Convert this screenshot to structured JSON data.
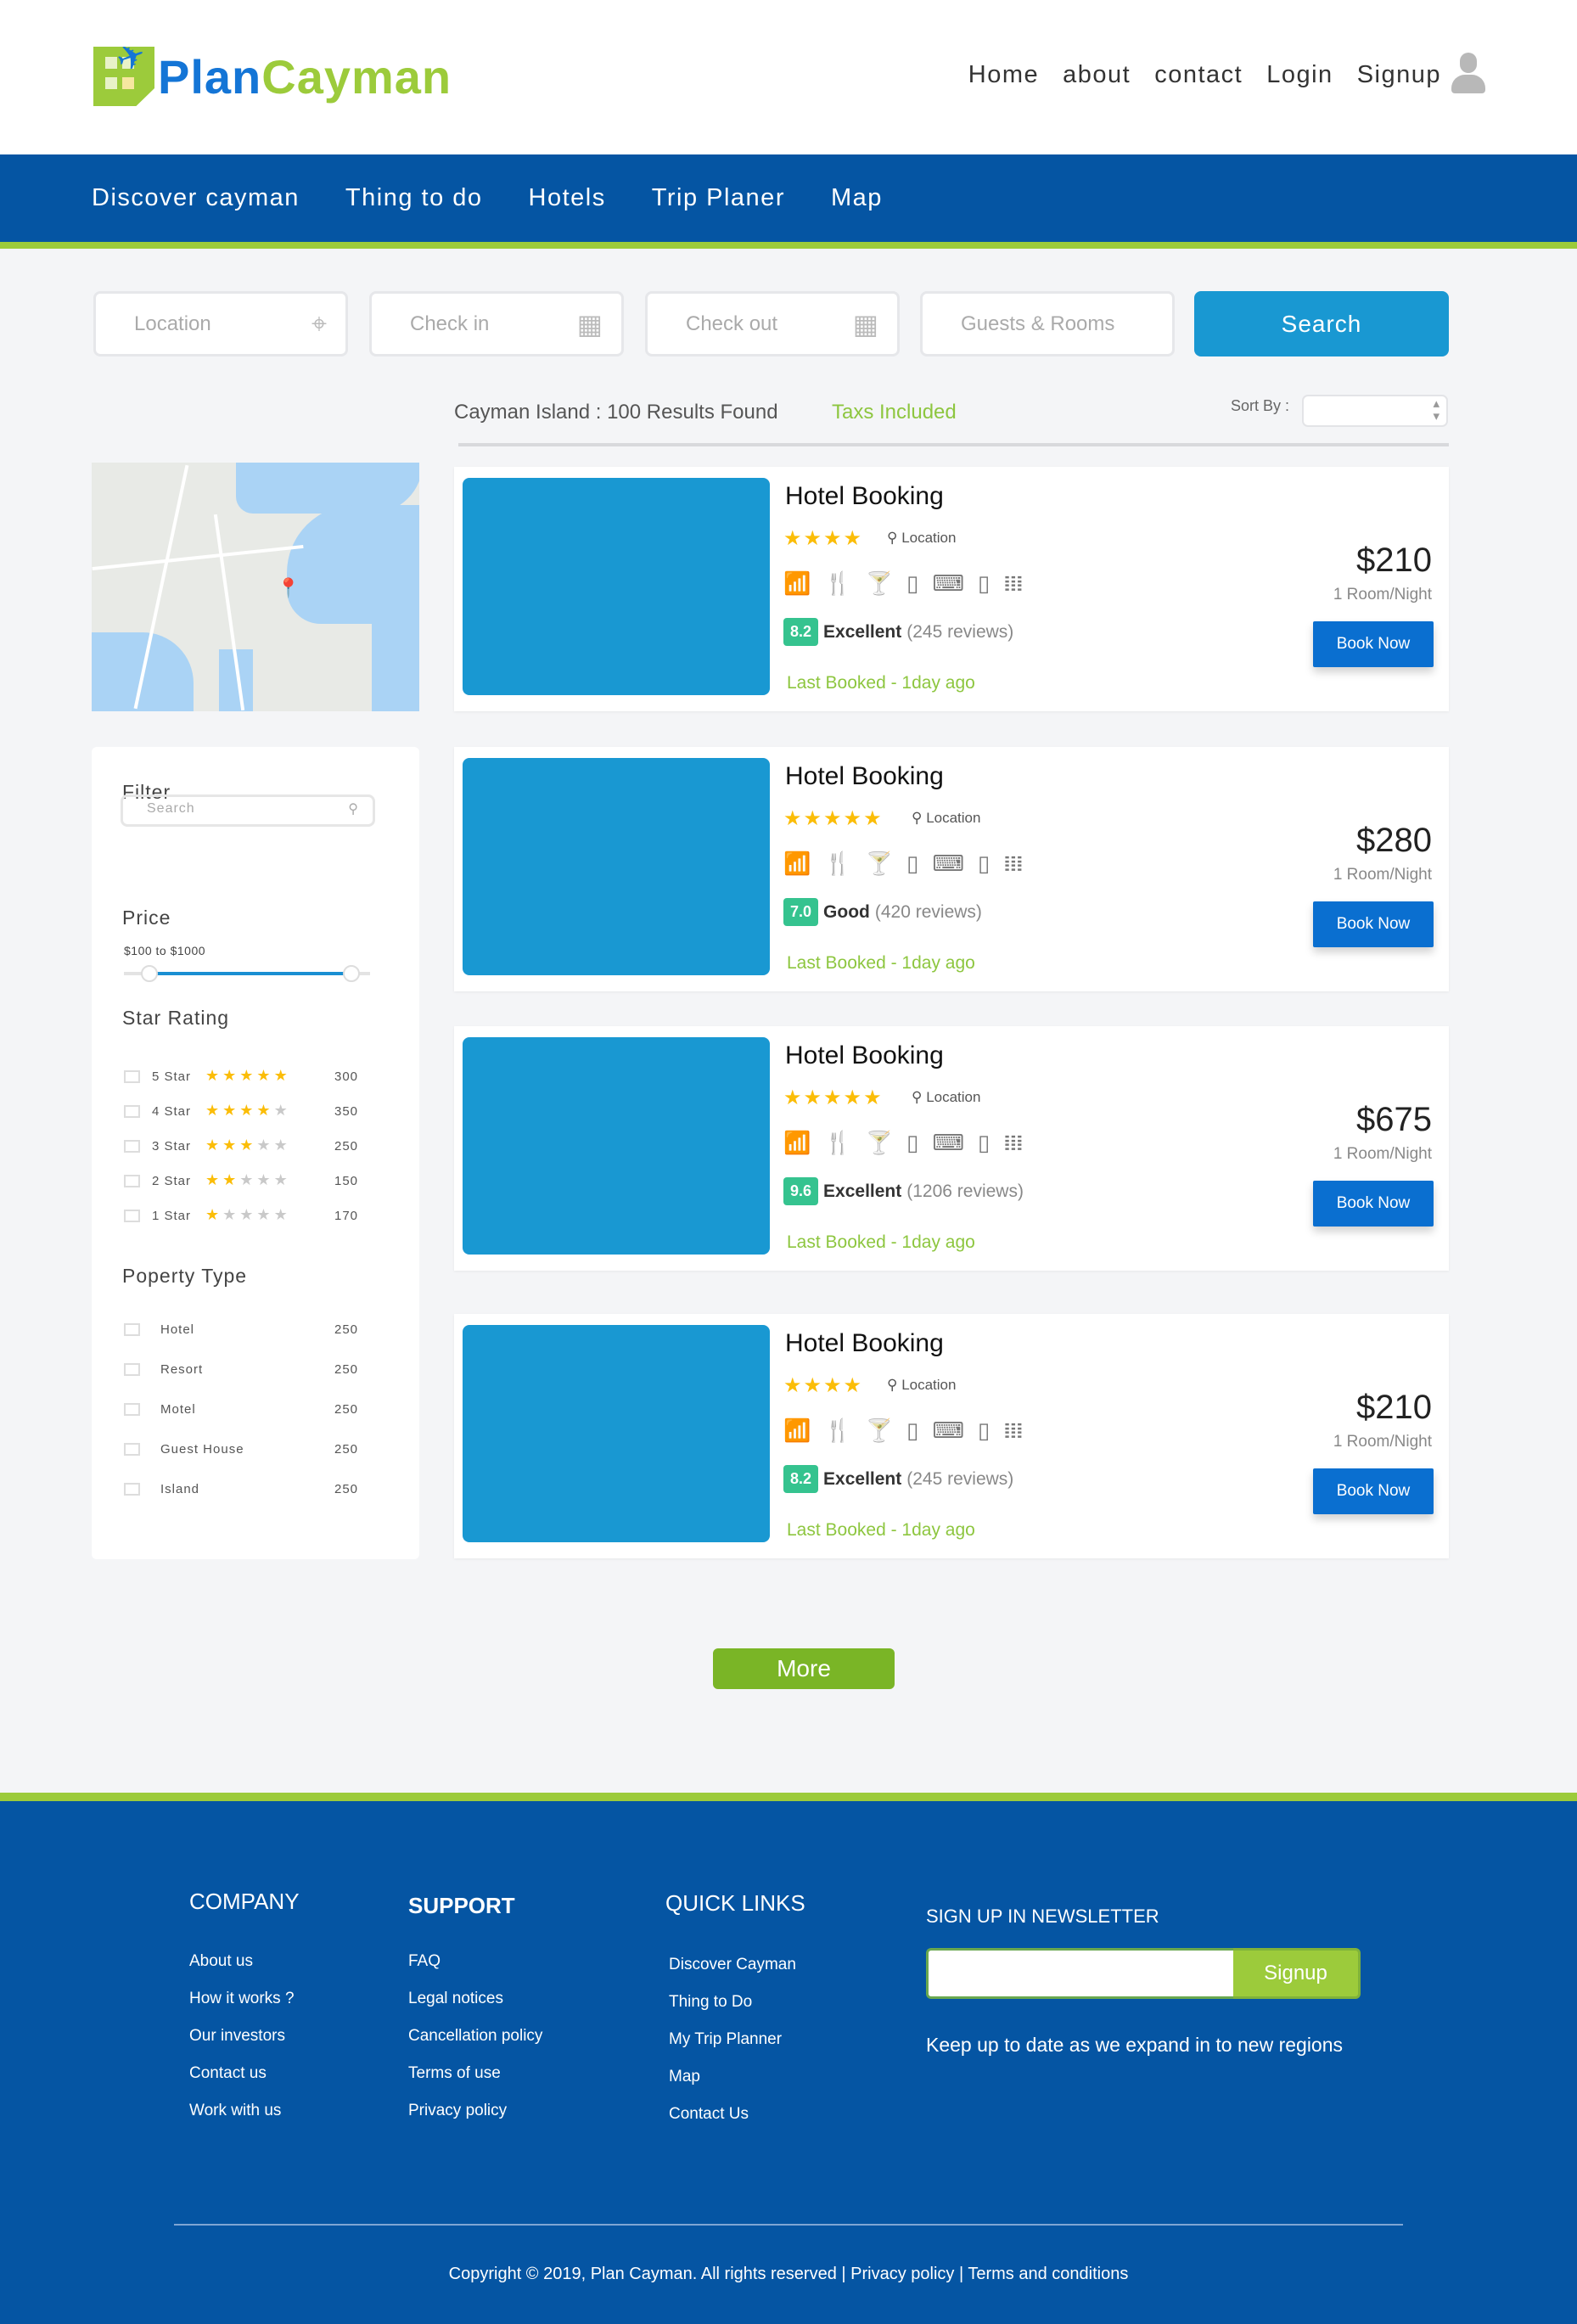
{
  "header": {
    "logo_plan": "Plan",
    "logo_cayman": "Cayman",
    "nav": [
      "Home",
      "about",
      "contact",
      "Login",
      "Signup"
    ]
  },
  "main_nav": [
    "Discover cayman",
    "Thing to do",
    "Hotels",
    "Trip Planer",
    "Map"
  ],
  "search": {
    "location": "Location",
    "check_in": "Check in",
    "check_out": "Check out",
    "guests": "Guests & Rooms",
    "button": "Search"
  },
  "results": {
    "summary": "Cayman Island : 100 Results Found",
    "taxes": "Taxs Included",
    "sort_label": "Sort By :"
  },
  "filter": {
    "title": "Filter",
    "search_placeholder": "Search",
    "price_title": "Price",
    "price_range": "$100 to $1000",
    "price_min": 100,
    "price_max": 1000,
    "star_title": "Star Rating",
    "stars": [
      {
        "label": "5 Star",
        "rating": 5,
        "count": "300"
      },
      {
        "label": "4 Star",
        "rating": 4,
        "count": "350"
      },
      {
        "label": "3 Star",
        "rating": 3,
        "count": "250"
      },
      {
        "label": "2 Star",
        "rating": 2,
        "count": "150"
      },
      {
        "label": "1 Star",
        "rating": 1,
        "count": "170"
      }
    ],
    "type_title": "Poperty Type",
    "types": [
      {
        "label": "Hotel",
        "count": "250"
      },
      {
        "label": "Resort",
        "count": "250"
      },
      {
        "label": "Motel",
        "count": "250"
      },
      {
        "label": "Guest House",
        "count": "250"
      },
      {
        "label": "Island",
        "count": "250"
      }
    ]
  },
  "hotels": [
    {
      "title": "Hotel Booking",
      "stars": 4,
      "location": "Location",
      "score": "8.2",
      "rating": "Excellent",
      "reviews": "(245 reviews)",
      "last": "Last Booked - 1day ago",
      "price": "$210",
      "per": "1 Room/Night",
      "book": "Book Now"
    },
    {
      "title": "Hotel Booking",
      "stars": 5,
      "location": "Location",
      "score": "7.0",
      "rating": "Good",
      "reviews": "(420 reviews)",
      "last": "Last Booked - 1day ago",
      "price": "$280",
      "per": "1 Room/Night",
      "book": "Book Now"
    },
    {
      "title": "Hotel Booking",
      "stars": 5,
      "location": "Location",
      "score": "9.6",
      "rating": "Excellent",
      "reviews": "(1206 reviews)",
      "last": "Last Booked - 1day ago",
      "price": "$675",
      "per": "1 Room/Night",
      "book": "Book Now"
    },
    {
      "title": "Hotel Booking",
      "stars": 4,
      "location": "Location",
      "score": "8.2",
      "rating": "Excellent",
      "reviews": "(245 reviews)",
      "last": "Last Booked - 1day ago",
      "price": "$210",
      "per": "1 Room/Night",
      "book": "Book Now"
    }
  ],
  "more": "More",
  "footer": {
    "company": {
      "title": "COMPANY",
      "links": [
        "About us",
        "How it works ?",
        "Our investors",
        "Contact us",
        "Work with us"
      ]
    },
    "support": {
      "title": "SUPPORT",
      "links": [
        "FAQ",
        "Legal notices",
        "Cancellation policy",
        "Terms of use",
        "Privacy policy"
      ]
    },
    "quick": {
      "title": "QUICK LINKS",
      "links": [
        "Discover Cayman",
        "Thing to Do",
        "My Trip Planner",
        "Map",
        "Contact Us"
      ]
    },
    "newsletter": {
      "title": "SIGN UP IN NEWSLETTER",
      "button": "Signup",
      "tagline": "Keep up to date as we expand in to new regions"
    },
    "copyright": "Copyright © 2019, Plan Cayman. All rights reserved  |  Privacy policy  |  Terms and conditions"
  }
}
